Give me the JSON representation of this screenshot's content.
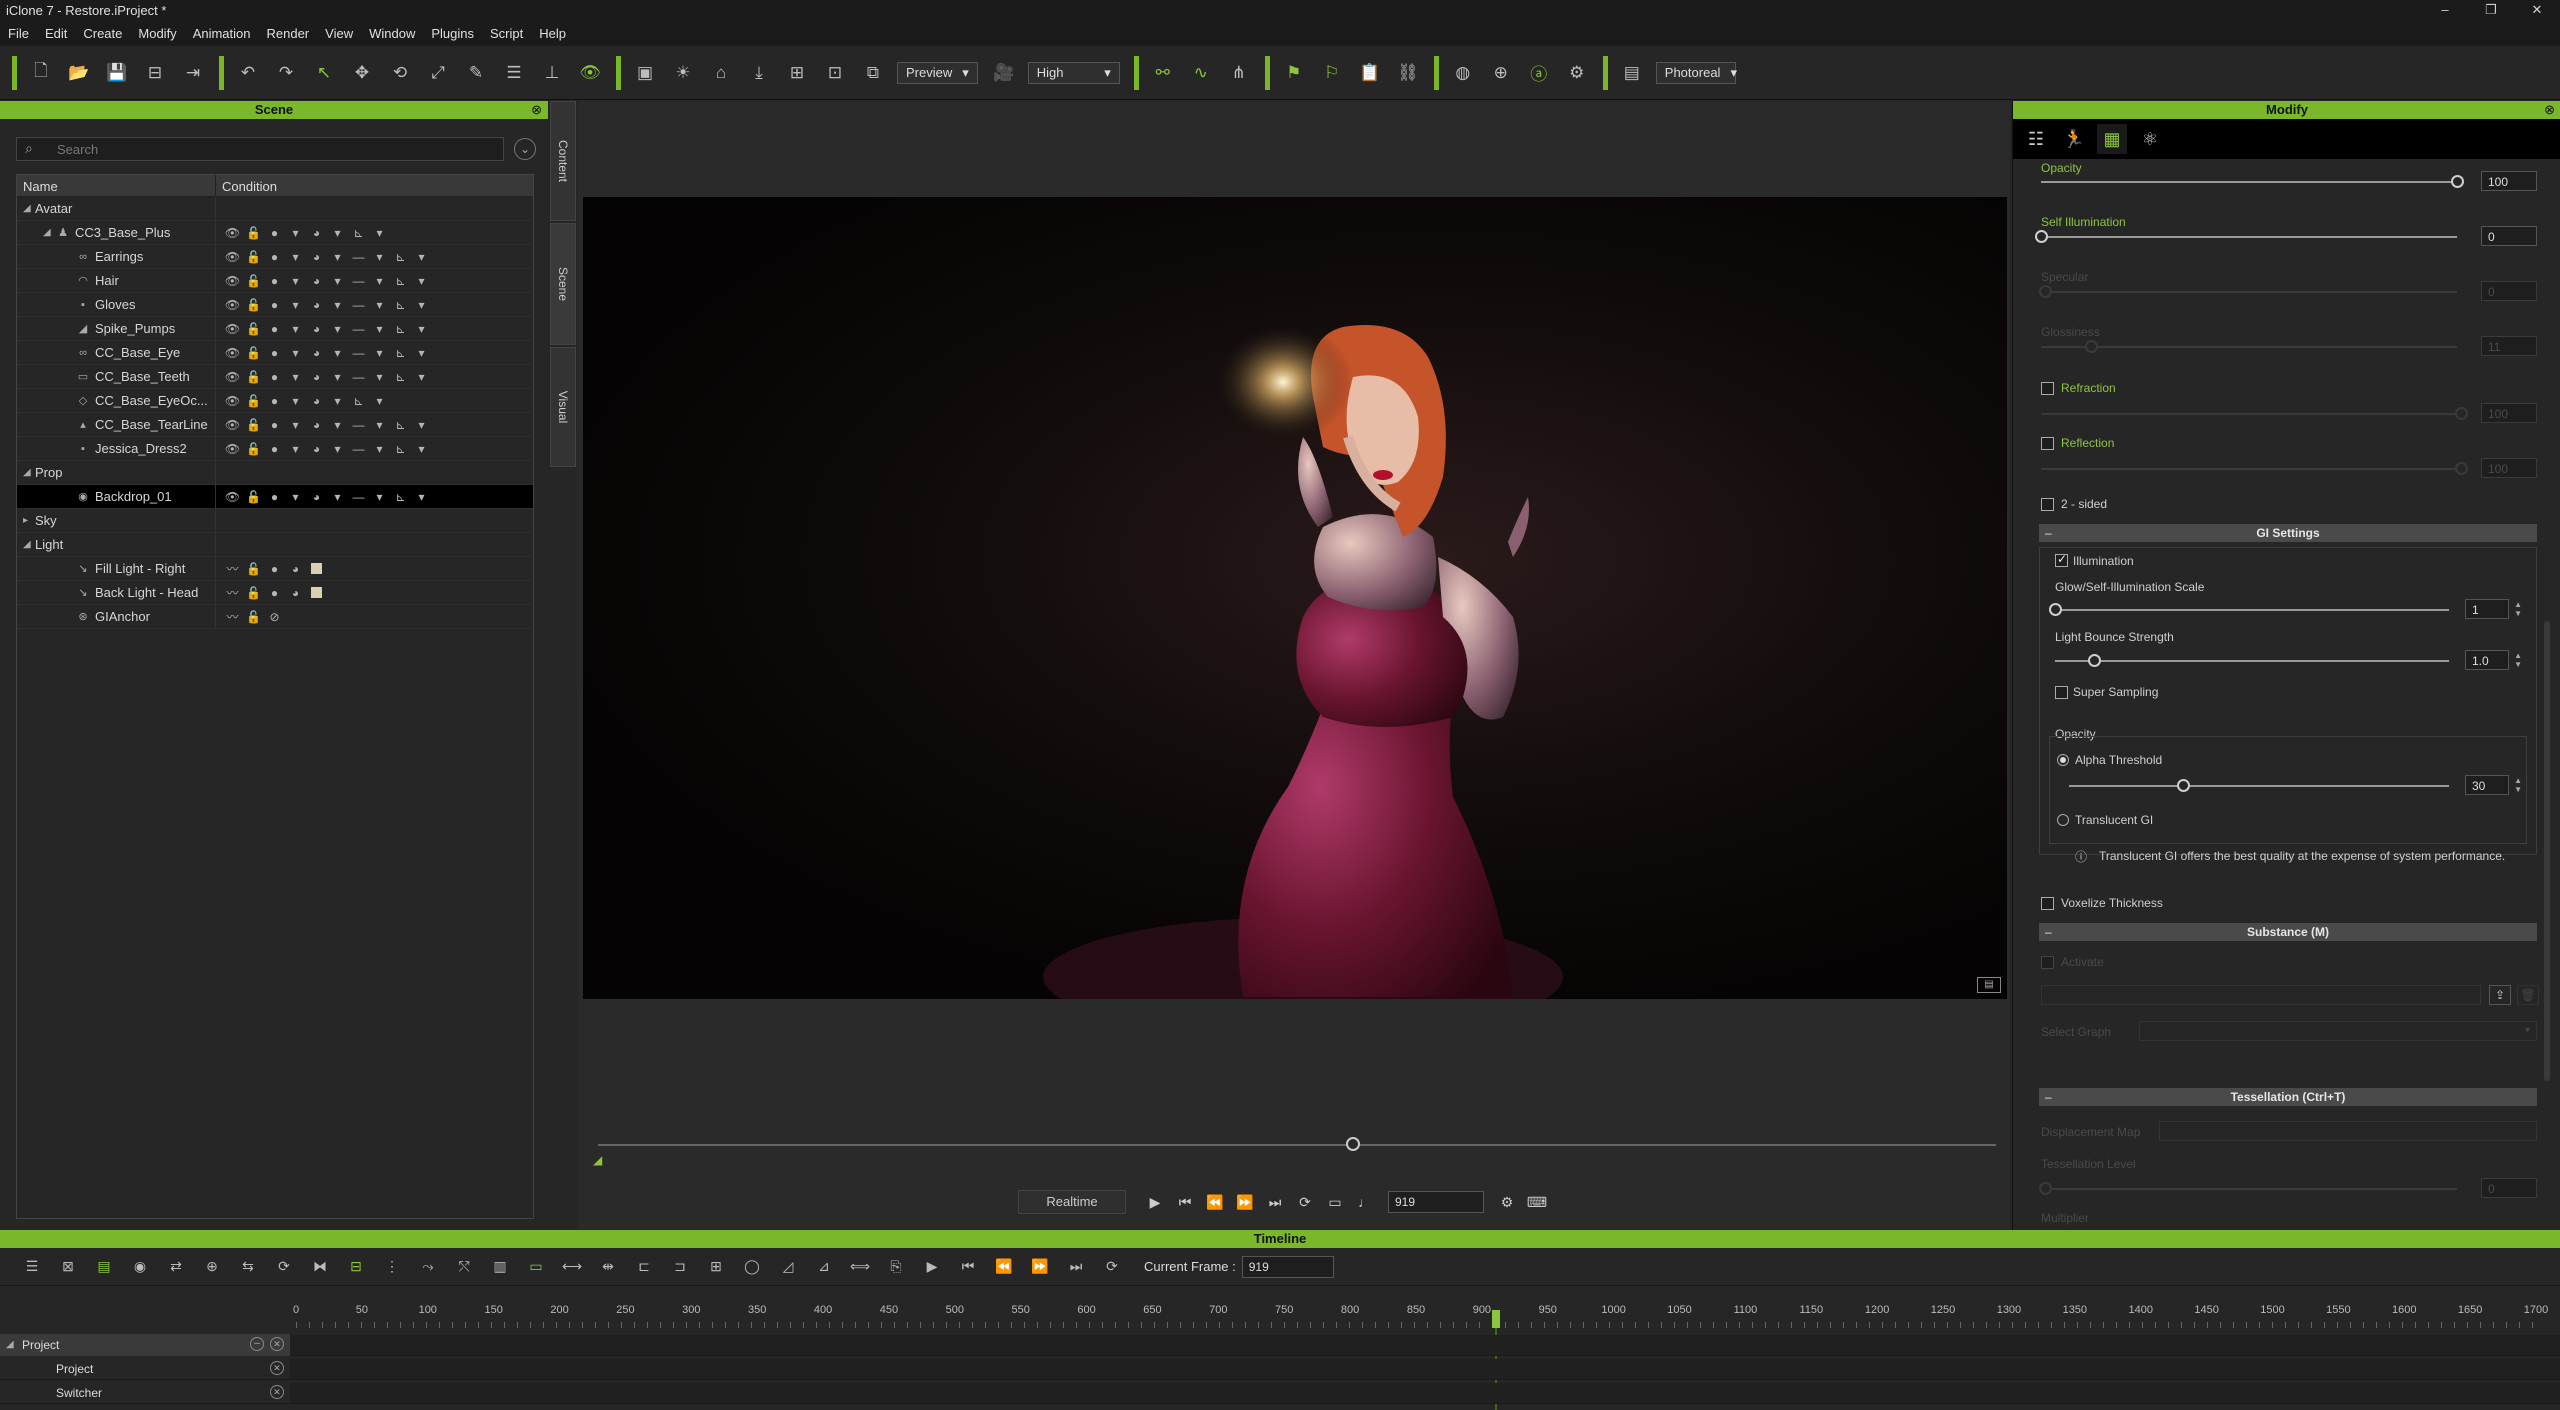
{
  "window": {
    "title": "iClone 7 - Restore.iProject *",
    "minimize": "–",
    "maximize": "❐",
    "close": "✕"
  },
  "menu": [
    "File",
    "Edit",
    "Create",
    "Modify",
    "Animation",
    "Render",
    "View",
    "Window",
    "Plugins",
    "Script",
    "Help"
  ],
  "toolbar": {
    "preview_mode": "Preview",
    "quality": "High",
    "render_mode": "Photoreal",
    "dropdown_arrow": "▾"
  },
  "scene": {
    "title": "Scene",
    "close": "⊗",
    "search_placeholder": "Search",
    "col_name": "Name",
    "col_condition": "Condition",
    "tabs": [
      "Content",
      "Scene",
      "Visual"
    ],
    "rows": [
      {
        "label": "Avatar",
        "arrow": "◢",
        "ico": "",
        "indent": 0,
        "cond": ""
      },
      {
        "label": "CC3_Base_Plus",
        "arrow": "◢",
        "ico": "♟",
        "indent": 1,
        "cond": "avatar"
      },
      {
        "label": "Earrings",
        "arrow": "",
        "ico": "∞",
        "indent": 2,
        "cond": "mesh"
      },
      {
        "label": "Hair",
        "arrow": "",
        "ico": "◠",
        "indent": 2,
        "cond": "mesh"
      },
      {
        "label": "Gloves",
        "arrow": "",
        "ico": "▪",
        "indent": 2,
        "cond": "mesh"
      },
      {
        "label": "Spike_Pumps",
        "arrow": "",
        "ico": "◢",
        "indent": 2,
        "cond": "mesh"
      },
      {
        "label": "CC_Base_Eye",
        "arrow": "",
        "ico": "∞",
        "indent": 2,
        "cond": "mesh"
      },
      {
        "label": "CC_Base_Teeth",
        "arrow": "",
        "ico": "▭",
        "indent": 2,
        "cond": "mesh"
      },
      {
        "label": "CC_Base_EyeOc...",
        "arrow": "",
        "ico": "◇",
        "indent": 2,
        "cond": "mesh2"
      },
      {
        "label": "CC_Base_TearLine",
        "arrow": "",
        "ico": "▴",
        "indent": 2,
        "cond": "mesh"
      },
      {
        "label": "Jessica_Dress2",
        "arrow": "",
        "ico": "▪",
        "indent": 2,
        "cond": "mesh"
      },
      {
        "label": "Prop",
        "arrow": "◢",
        "ico": "",
        "indent": 0,
        "cond": ""
      },
      {
        "label": "Backdrop_01",
        "arrow": "",
        "ico": "◉",
        "indent": 2,
        "cond": "mesh",
        "selected": true
      },
      {
        "label": "Sky",
        "arrow": "▸",
        "ico": "",
        "indent": 0,
        "cond": ""
      },
      {
        "label": "Light",
        "arrow": "◢",
        "ico": "",
        "indent": 0,
        "cond": ""
      },
      {
        "label": "Fill Light - Right",
        "arrow": "",
        "ico": "↘",
        "indent": 2,
        "cond": "light"
      },
      {
        "label": "Back Light - Head",
        "arrow": "",
        "ico": "↘",
        "indent": 2,
        "cond": "light"
      },
      {
        "label": "GIAnchor",
        "arrow": "",
        "ico": "⊛",
        "indent": 2,
        "cond": "anchor"
      }
    ],
    "cond_glyphs": {
      "avatar": [
        "👁",
        "🔓",
        "●",
        "▾",
        "◕",
        "▾",
        "⊾",
        "▾"
      ],
      "mesh": [
        "👁",
        "🔓",
        "●",
        "▾",
        "◕",
        "▾",
        "—",
        "▾",
        "⊾",
        "▾"
      ],
      "mesh2": [
        "👁",
        "🔓",
        "●",
        "▾",
        "◕",
        "▾",
        "⊾",
        "▾"
      ],
      "light": [
        "〰",
        "🔓",
        "●",
        "◕"
      ],
      "anchor": [
        "〰",
        "🔓",
        "⊘"
      ]
    }
  },
  "viewport": {
    "playback_mode": "Realtime",
    "current_frame": "919",
    "controls": [
      "▶",
      "⏮",
      "⏪",
      "⏩",
      "⏭"
    ],
    "msg_icon": "▤"
  },
  "modify": {
    "title": "Modify",
    "close": "⊗",
    "opacity_label": "Opacity",
    "opacity_value": "100",
    "opacity_level": 1.0,
    "self_illum_label": "Self Illumination",
    "self_illum_value": "0",
    "self_illum_level": 0.0,
    "specular_label": "Specular",
    "specular_value": "0",
    "glossiness_label": "Glossiness",
    "glossiness_value": "11",
    "refraction_label": "Refraction",
    "refraction_value": "100",
    "reflection_label": "Reflection",
    "reflection_value": "100",
    "two_sided_label": "2 - sided",
    "gi_settings": "GI Settings",
    "illumination_label": "Illumination",
    "glow_scale_label": "Glow/Self-Illumination Scale",
    "glow_scale_value": "1",
    "glow_scale_level": 0.0,
    "bounce_label": "Light Bounce Strength",
    "bounce_value": "1.0",
    "bounce_level": 0.1,
    "super_sampling_label": "Super Sampling",
    "gi_opacity_label": "Opacity",
    "alpha_threshold_label": "Alpha Threshold",
    "alpha_threshold_value": "30",
    "alpha_threshold_level": 0.3,
    "translucent_gi_label": "Translucent GI",
    "translucent_info": "Translucent GI offers the best quality at the expense of system performance.",
    "voxelize_label": "Voxelize Thickness",
    "substance": "Substance (M)",
    "activate_label": "Activate",
    "select_graph_label": "Select Graph",
    "tessellation": "Tessellation  (Ctrl+T)",
    "displacement_label": "Displacement Map",
    "tess_level_label": "Tessellation Level",
    "tess_level_value": "0",
    "multiplier_label": "Multiplier",
    "minus": "–",
    "info_icon": "ⓘ"
  },
  "timeline": {
    "title": "Timeline",
    "current_frame_label": "Current Frame :",
    "current_frame": "919",
    "ruler": [
      "0",
      "50",
      "100",
      "150",
      "200",
      "250",
      "300",
      "350",
      "400",
      "450",
      "500",
      "550",
      "600",
      "650",
      "700",
      "750",
      "800",
      "850",
      "900",
      "950",
      "1000",
      "1050",
      "1100",
      "1150",
      "1200",
      "1250",
      "1300",
      "1350",
      "1400",
      "1450",
      "1500",
      "1550",
      "1600",
      "1650",
      "1700"
    ],
    "tracks": [
      {
        "label": "Project",
        "indent": 0,
        "arrow": "◢"
      },
      {
        "label": "Project",
        "indent": 1,
        "arrow": ""
      },
      {
        "label": "Switcher",
        "indent": 1,
        "arrow": ""
      }
    ],
    "close_glyph": "✕",
    "minus_glyph": "–"
  },
  "colors": {
    "accent": "#7ab82a",
    "panel": "#262626",
    "dark": "#1b1b1b"
  }
}
